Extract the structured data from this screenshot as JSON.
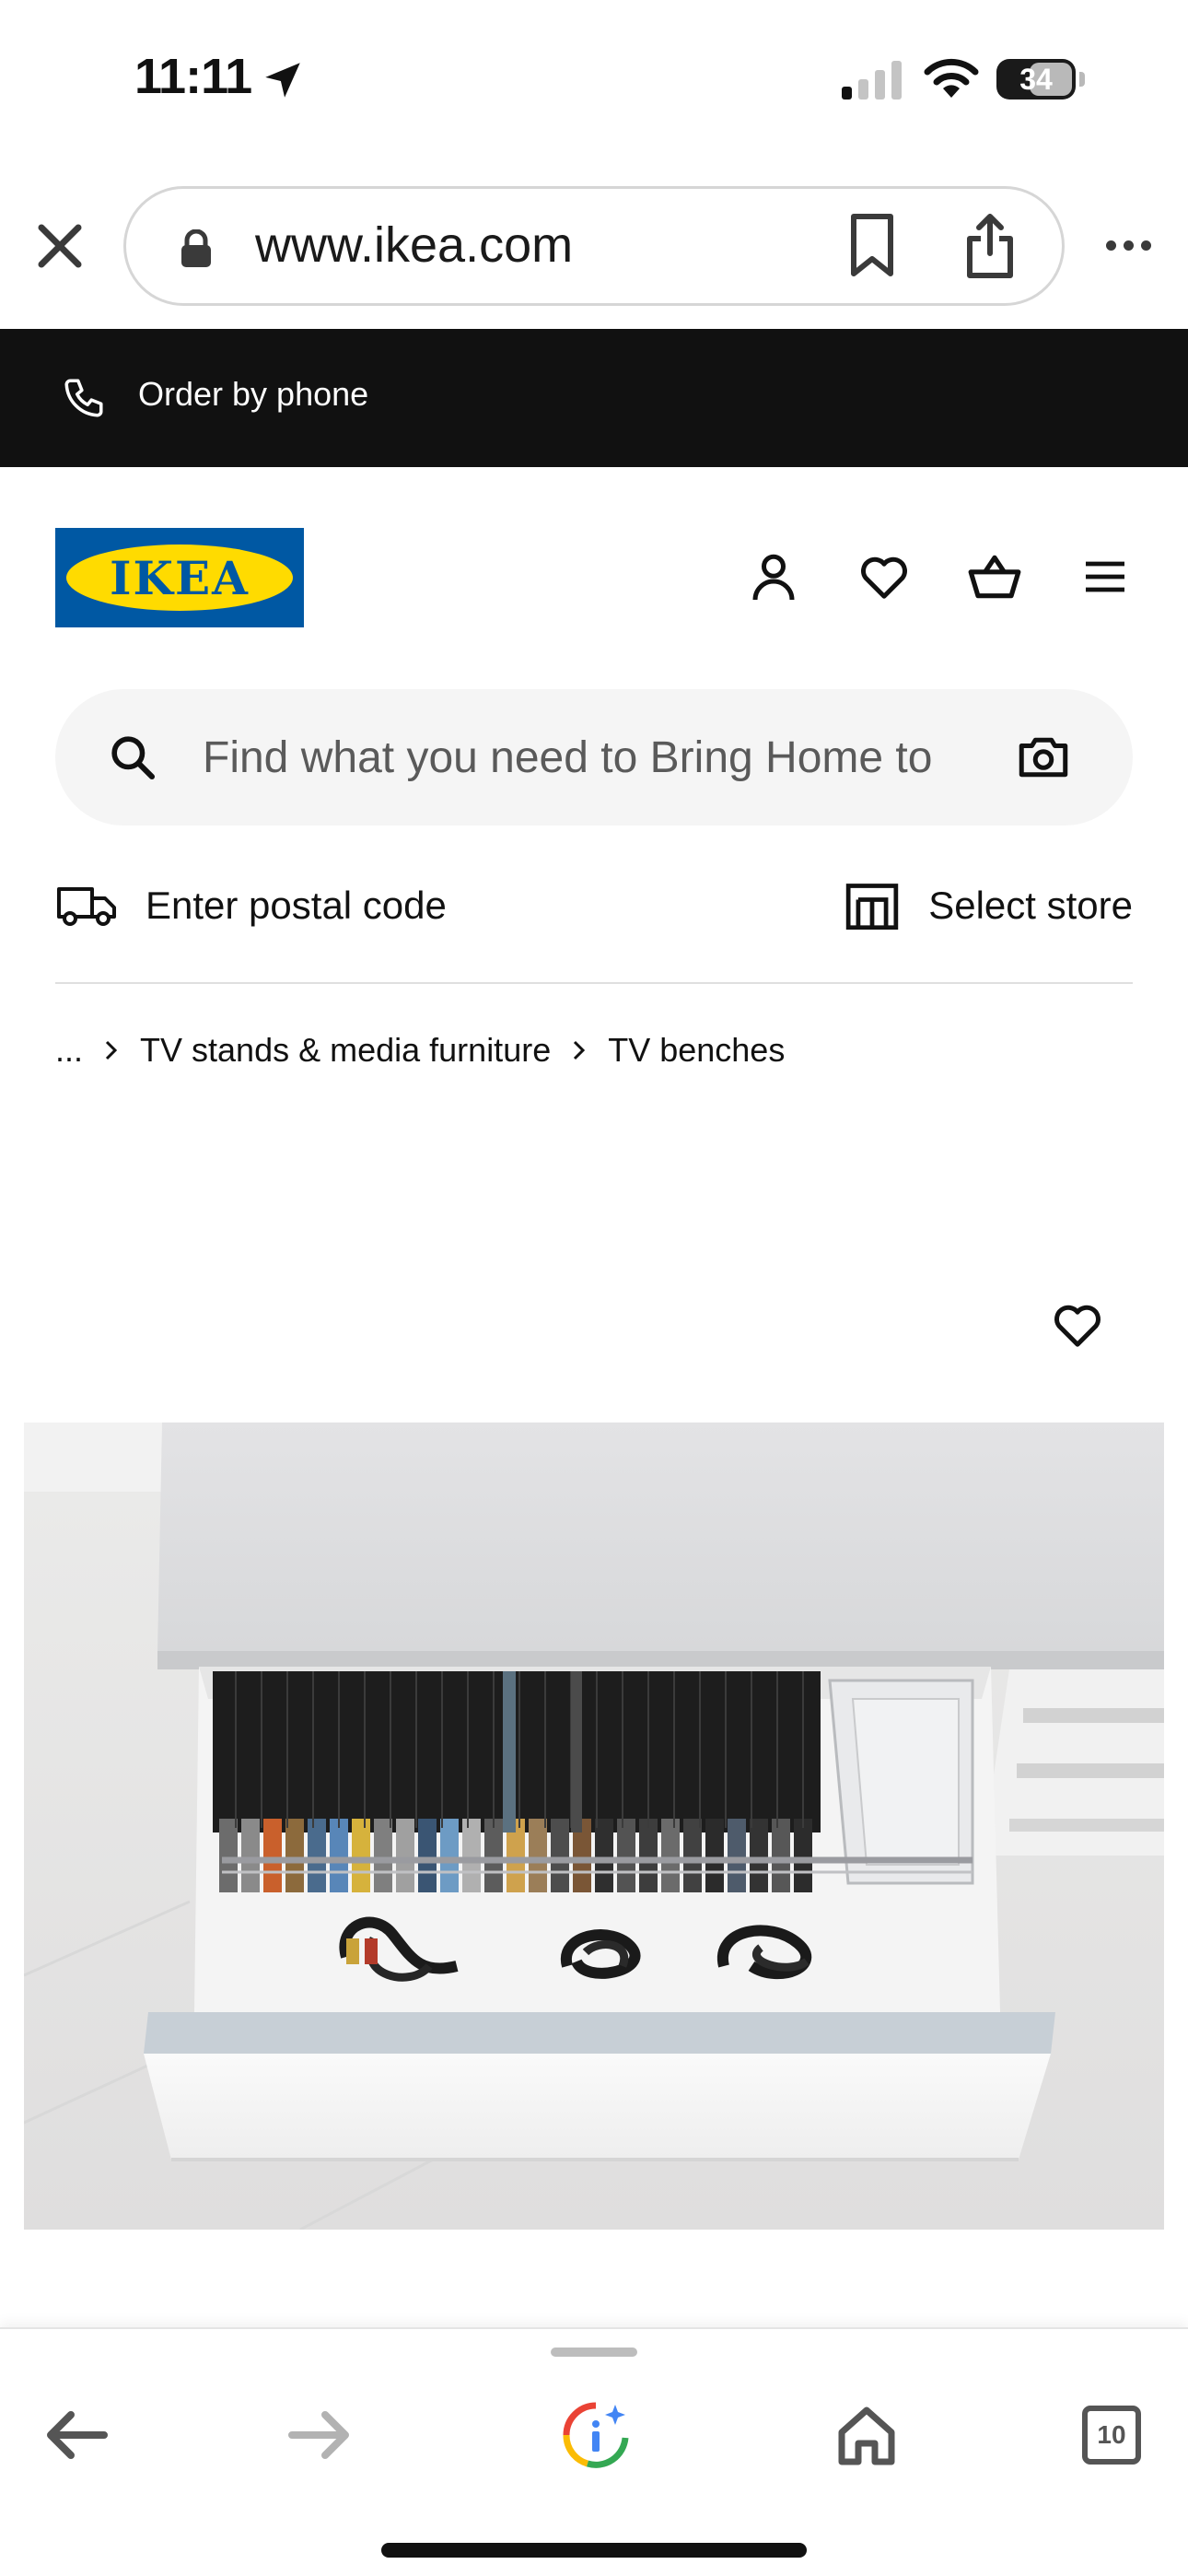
{
  "status_bar": {
    "time": "11:11",
    "battery": "34",
    "icons": [
      "location-arrow-icon",
      "signal-icon",
      "wifi-icon",
      "battery-icon"
    ]
  },
  "browser": {
    "url": "www.ikea.com",
    "icons": [
      "close-icon",
      "lock-icon",
      "bookmark-icon",
      "share-icon",
      "more-icon"
    ]
  },
  "banner": {
    "text": "Order by phone",
    "icon": "phone-icon"
  },
  "header": {
    "logo_text": "IKEA",
    "brand_colors": {
      "blue": "#0058a3",
      "yellow": "#ffdb00"
    },
    "icons": [
      "account-icon",
      "heart-icon",
      "basket-icon",
      "menu-icon"
    ]
  },
  "search": {
    "placeholder": "Find what you need to Bring Home to",
    "icons": [
      "search-icon",
      "camera-icon"
    ]
  },
  "delivery": {
    "postal_label": "Enter postal code",
    "store_label": "Select store",
    "icons": [
      "truck-icon",
      "store-icon"
    ]
  },
  "breadcrumb": {
    "ellipsis": "...",
    "items": [
      "TV stands & media furniture",
      "TV benches"
    ]
  },
  "product": {
    "favourite_icon": "heart-icon",
    "image": "white TV bench drawer open with DVDs and cables"
  },
  "bottom_nav": {
    "tabs_count": "10",
    "icons": [
      "back-arrow-icon",
      "forward-arrow-icon",
      "google-assistant-icon",
      "home-icon",
      "tabs-icon"
    ]
  }
}
